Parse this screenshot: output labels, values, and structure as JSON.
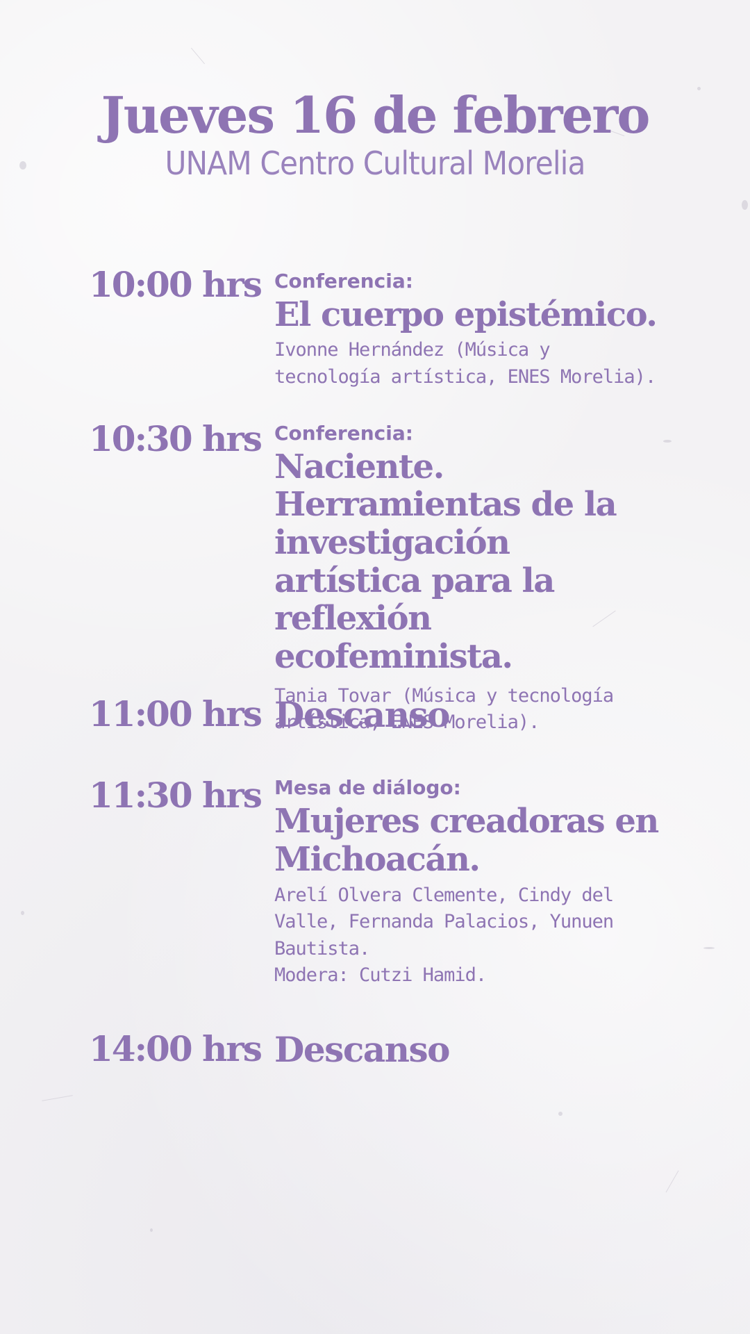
{
  "header": {
    "title": "Jueves 16 de febrero",
    "subtitle": "UNAM Centro Cultural Morelia"
  },
  "schedule": [
    {
      "time": "10:00 hrs",
      "kind": "Conferencia:",
      "title": "El cuerpo epistémico.",
      "description": [
        "Ivonne Hernández (Música y tecnología artística, ENES Morelia)."
      ]
    },
    {
      "time": "10:30 hrs",
      "kind": "Conferencia:",
      "title": "Naciente. Herramientas de la investigación artística para la reflexión ecofeminista.",
      "description": [
        "Tania Tovar (Música y tecnología artística, ENES Morelia)."
      ]
    },
    {
      "time": "11:00 hrs",
      "title": "Descanso"
    },
    {
      "time": "11:30 hrs",
      "kind": "Mesa de diálogo:",
      "title": "Mujeres creadoras en Michoacán.",
      "description": [
        "Arelí Olvera Clemente, Cindy del Valle, Fernanda Palacios, Yunuen Bautista.",
        "Modera: Cutzi Hamid."
      ]
    },
    {
      "time": "14:00 hrs",
      "title": "Descanso"
    }
  ],
  "colors": {
    "accent": "#8e74b3",
    "background": "#f3f2f4"
  }
}
